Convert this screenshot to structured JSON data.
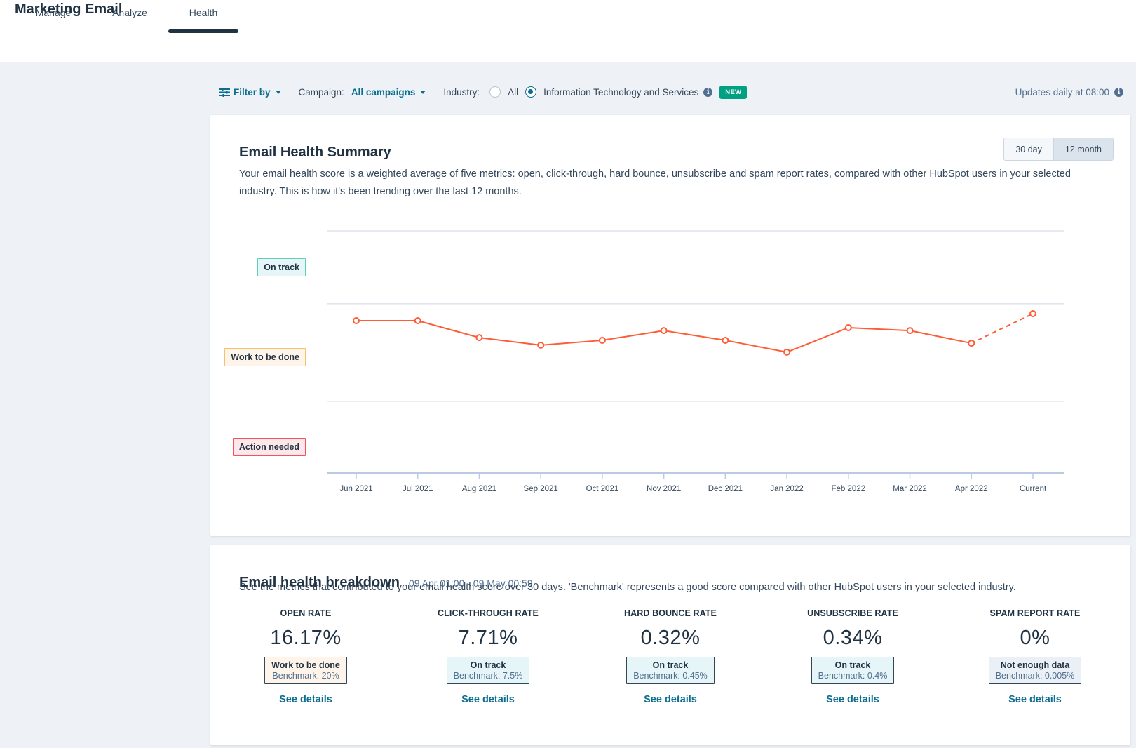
{
  "app": {
    "title": "Marketing Email",
    "tabs": [
      {
        "label": "Manage",
        "active": false
      },
      {
        "label": "Analyze",
        "active": false
      },
      {
        "label": "Health",
        "active": true
      }
    ]
  },
  "filters": {
    "filter_by_label": "Filter by",
    "campaign_label": "Campaign:",
    "campaign_value": "All campaigns",
    "industry_label": "Industry:",
    "industry_options": [
      {
        "label": "All",
        "selected": false
      },
      {
        "label": "Information Technology and Services",
        "selected": true
      }
    ],
    "new_badge": "NEW",
    "updates_text": "Updates daily at 08:00"
  },
  "summary": {
    "title": "Email Health Summary",
    "description": "Your email health score is a weighted average of five metrics: open, click-through, hard bounce, unsubscribe and spam report rates, compared with other HubSpot users in your selected industry. This is how it's been trending over the last 12 months.",
    "range_options": [
      {
        "label": "30 day",
        "selected": false
      },
      {
        "label": "12 month",
        "selected": true
      }
    ]
  },
  "chart_data": {
    "type": "line",
    "title": "Email Health Summary",
    "xlabel": "",
    "ylabel": "",
    "y_scale": "normalized health score (0 = axis, 100 = top gridline), estimated from pixel positions",
    "ylim": [
      0,
      100
    ],
    "grid": true,
    "zones": [
      {
        "label": "On track",
        "from": 69.9,
        "to": 100,
        "color": "#5fcfb8"
      },
      {
        "label": "Work to be done",
        "from": 29.6,
        "to": 69.9,
        "color": "#f5c26b"
      },
      {
        "label": "Action needed",
        "from": 0,
        "to": 29.6,
        "color": "#f2545b"
      }
    ],
    "categories": [
      "Jun 2021",
      "Jul 2021",
      "Aug 2021",
      "Sep 2021",
      "Oct 2021",
      "Nov 2021",
      "Dec 2021",
      "Jan 2022",
      "Feb 2022",
      "Mar 2022",
      "Apr 2022",
      "Current"
    ],
    "series": [
      {
        "name": "Email health score",
        "color": "#ff5c35",
        "values": [
          62.9,
          62.9,
          55.9,
          52.8,
          54.8,
          58.8,
          54.8,
          49.9,
          60.0,
          58.8,
          53.6,
          65.8
        ],
        "dashed_last_segment": true
      }
    ]
  },
  "breakdown": {
    "title": "Email health breakdown",
    "date_range": "09 Apr 01:00 - 09 May 00:59",
    "description": "See the metrics that contributed to your email health score over 30 days. 'Benchmark' represents a good score compared with other HubSpot users in your selected industry.",
    "metrics": [
      {
        "label": "OPEN RATE",
        "value": "16.17%",
        "status": "Work to be done",
        "benchmark": "Benchmark: 20%",
        "link": "See details"
      },
      {
        "label": "CLICK-THROUGH RATE",
        "value": "7.71%",
        "status": "On track",
        "benchmark": "Benchmark: 7.5%",
        "link": "See details"
      },
      {
        "label": "HARD BOUNCE RATE",
        "value": "0.32%",
        "status": "On track",
        "benchmark": "Benchmark: 0.45%",
        "link": "See details"
      },
      {
        "label": "UNSUBSCRIBE RATE",
        "value": "0.34%",
        "status": "On track",
        "benchmark": "Benchmark: 0.4%",
        "link": "See details"
      },
      {
        "label": "SPAM REPORT RATE",
        "value": "0%",
        "status": "Not enough data",
        "benchmark": "Benchmark: 0.005%",
        "link": "See details"
      }
    ]
  }
}
